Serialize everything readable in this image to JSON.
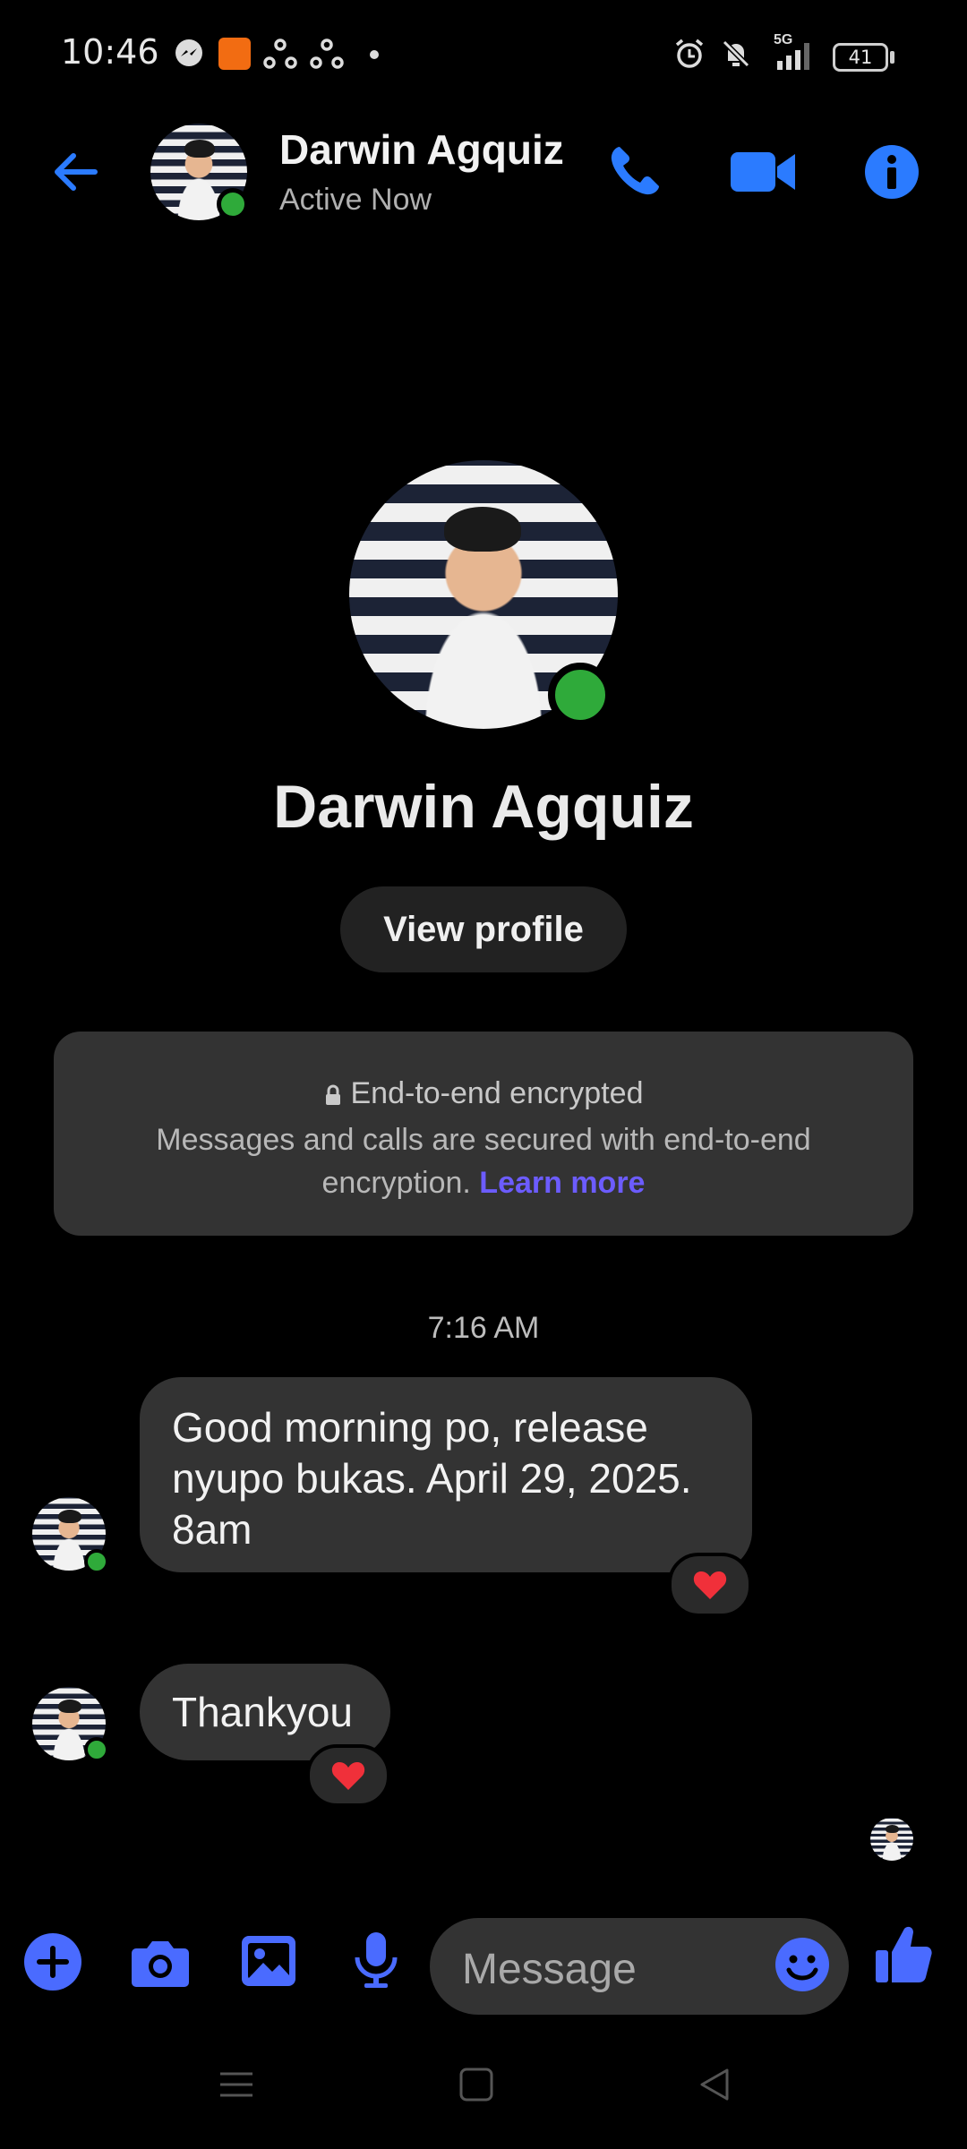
{
  "colors": {
    "accent": "#2b7bff",
    "composer_blue": "#4a6bff",
    "online": "#2faa3a",
    "link": "#6c5cff"
  },
  "status_bar": {
    "time": "10:46",
    "battery": "41",
    "signal_label": "5G"
  },
  "header": {
    "name": "Darwin Agquiz",
    "status": "Active Now"
  },
  "profile": {
    "name": "Darwin Agquiz",
    "view_profile_label": "View profile"
  },
  "encryption": {
    "title": "End-to-end encrypted",
    "body": "Messages and calls are secured with end-to-end encryption.",
    "link": "Learn more"
  },
  "conversation": {
    "timestamp": "7:16 AM",
    "messages": [
      {
        "line1": "Good morning po, release",
        "line2": "nyupo bukas. April 29, 2025.",
        "line3": "8am",
        "reaction": "heart"
      },
      {
        "text": "Thankyou",
        "reaction": "heart"
      }
    ]
  },
  "composer": {
    "placeholder": "Message"
  }
}
